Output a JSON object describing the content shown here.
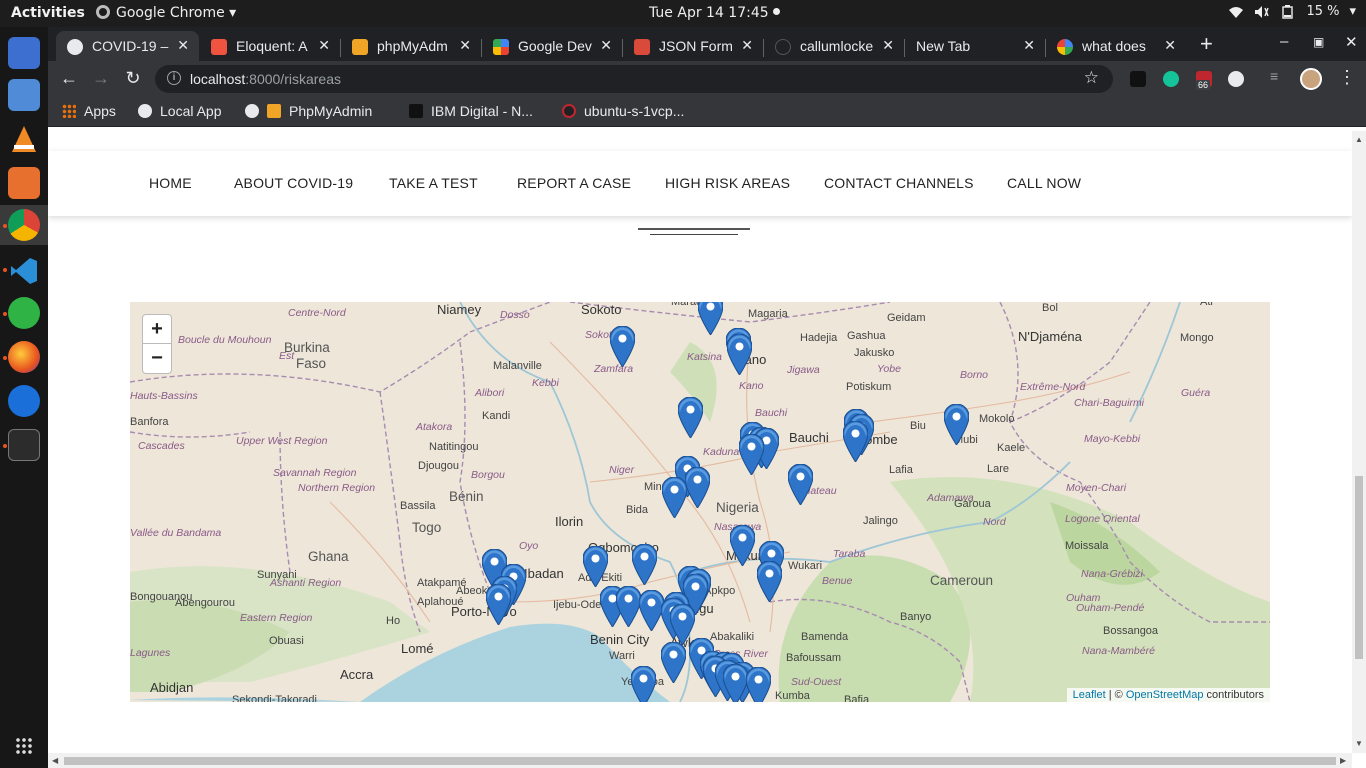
{
  "system": {
    "activities": "Activities",
    "app_name": "Google Chrome",
    "clock": "Tue Apr 14  17:45",
    "battery": "15 %"
  },
  "browser": {
    "tabs": [
      {
        "title": "COVID-19 –",
        "active": true
      },
      {
        "title": "Eloquent: A",
        "active": false
      },
      {
        "title": "phpMyAdm",
        "active": false
      },
      {
        "title": "Google Dev",
        "active": false
      },
      {
        "title": "JSON Form",
        "active": false
      },
      {
        "title": "callumlocke",
        "active": false
      },
      {
        "title": "New Tab",
        "active": false
      },
      {
        "title": "what does",
        "active": false
      }
    ],
    "url_host": "localhost",
    "url_path": ":8000/riskareas",
    "extension_badge": "66",
    "bookmarks": [
      "Apps",
      "Local App",
      "PhpMyAdmin",
      "IBM Digital - N...",
      "ubuntu-s-1vcp..."
    ]
  },
  "nav": {
    "items": [
      "HOME",
      "ABOUT COVID-19",
      "TAKE A TEST",
      "REPORT A CASE",
      "HIGH RISK AREAS",
      "CONTACT CHANNELS",
      "CALL NOW"
    ]
  },
  "map": {
    "zoom_in": "+",
    "zoom_out": "−",
    "attribution": {
      "leaflet": "Leaflet",
      "sep": " | © ",
      "osm": "OpenStreetMap",
      "suffix": " contributors"
    },
    "places": [
      {
        "t": "Niamey",
        "cls": "big"
      },
      {
        "t": "Sokoto",
        "cls": "big"
      },
      {
        "t": "Maradi",
        "cls": ""
      },
      {
        "t": "Magaria",
        "cls": ""
      },
      {
        "t": "Geidam",
        "cls": ""
      },
      {
        "t": "Bol",
        "cls": ""
      },
      {
        "t": "Ati",
        "cls": ""
      },
      {
        "t": "Centre-Nord",
        "cls": "region"
      },
      {
        "t": "Dosso",
        "cls": "region"
      },
      {
        "t": "Sokoto",
        "cls": "region"
      },
      {
        "t": "Hadejia",
        "cls": ""
      },
      {
        "t": "Gashua",
        "cls": ""
      },
      {
        "t": "N'Djaména",
        "cls": "big"
      },
      {
        "t": "Mongo",
        "cls": ""
      },
      {
        "t": "Boucle du Mouhoun",
        "cls": "region"
      },
      {
        "t": "Burkina",
        "cls": "country"
      },
      {
        "t": "Faso",
        "cls": "country"
      },
      {
        "t": "Malanville",
        "cls": ""
      },
      {
        "t": "Zamfara",
        "cls": "region"
      },
      {
        "t": "Katsina",
        "cls": "region"
      },
      {
        "t": "Kano",
        "cls": "big"
      },
      {
        "t": "Jigawa",
        "cls": "region"
      },
      {
        "t": "Jakusko",
        "cls": ""
      },
      {
        "t": "Yobe",
        "cls": "region"
      },
      {
        "t": "Borno",
        "cls": "region"
      },
      {
        "t": "Est",
        "cls": "region"
      },
      {
        "t": "Alibori",
        "cls": "region"
      },
      {
        "t": "Kebbi",
        "cls": "region"
      },
      {
        "t": "Kano",
        "cls": "region"
      },
      {
        "t": "Potiskum",
        "cls": ""
      },
      {
        "t": "Extrême-Nord",
        "cls": "region"
      },
      {
        "t": "Chari-Baguirmi",
        "cls": "region"
      },
      {
        "t": "Guéra",
        "cls": "region"
      },
      {
        "t": "Hauts-Bassins",
        "cls": "region"
      },
      {
        "t": "Kandi",
        "cls": ""
      },
      {
        "t": "Bauchi",
        "cls": "region"
      },
      {
        "t": "Banfora",
        "cls": ""
      },
      {
        "t": "Atakora",
        "cls": "region"
      },
      {
        "t": "Bauchi",
        "cls": "big"
      },
      {
        "t": "Gombe",
        "cls": "big"
      },
      {
        "t": "Biu",
        "cls": ""
      },
      {
        "t": "Mubi",
        "cls": ""
      },
      {
        "t": "Mokolo",
        "cls": ""
      },
      {
        "t": "Mayo-Kebbi",
        "cls": "region"
      },
      {
        "t": "Cascades",
        "cls": "region"
      },
      {
        "t": "Upper West Region",
        "cls": "region"
      },
      {
        "t": "Natitingou",
        "cls": ""
      },
      {
        "t": "Kaduna",
        "cls": "region"
      },
      {
        "t": "Kaele",
        "cls": ""
      },
      {
        "t": "Djougou",
        "cls": ""
      },
      {
        "t": "Niger",
        "cls": "region"
      },
      {
        "t": "Lafia",
        "cls": ""
      },
      {
        "t": "Lare",
        "cls": ""
      },
      {
        "t": "Borgou",
        "cls": "region"
      },
      {
        "t": "Plateau",
        "cls": "region"
      },
      {
        "t": "Savannah Region",
        "cls": "region"
      },
      {
        "t": "Northern Region",
        "cls": "region"
      },
      {
        "t": "Bénin",
        "cls": "country"
      },
      {
        "t": "Minna",
        "cls": ""
      },
      {
        "t": "Adamawa",
        "cls": "region"
      },
      {
        "t": "Garoua",
        "cls": ""
      },
      {
        "t": "Moyen-Chari",
        "cls": "region"
      },
      {
        "t": "Bassila",
        "cls": ""
      },
      {
        "t": "Bida",
        "cls": ""
      },
      {
        "t": "Nigeria",
        "cls": "country"
      },
      {
        "t": "Jalingo",
        "cls": ""
      },
      {
        "t": "Nord",
        "cls": "region"
      },
      {
        "t": "Vallée du Bandama",
        "cls": "region"
      },
      {
        "t": "Togo",
        "cls": "country"
      },
      {
        "t": "Ilorin",
        "cls": "big"
      },
      {
        "t": "Oyo",
        "cls": "region"
      },
      {
        "t": "Nasarawa",
        "cls": "region"
      },
      {
        "t": "Logone Oriental",
        "cls": "region"
      },
      {
        "t": "Ghana",
        "cls": "country"
      },
      {
        "t": "Ogbomosho",
        "cls": "big"
      },
      {
        "t": "Makurdi",
        "cls": "big"
      },
      {
        "t": "Taraba",
        "cls": "region"
      },
      {
        "t": "Moissala",
        "cls": ""
      },
      {
        "t": "Sunyani",
        "cls": ""
      },
      {
        "t": "Atakpamé",
        "cls": ""
      },
      {
        "t": "Ibadan",
        "cls": "big"
      },
      {
        "t": "Ado-Ekiti",
        "cls": ""
      },
      {
        "t": "Wukari",
        "cls": ""
      },
      {
        "t": "Cameroun",
        "cls": "country"
      },
      {
        "t": "Nana-Grébizi",
        "cls": "region"
      },
      {
        "t": "Abeokuta",
        "cls": ""
      },
      {
        "t": "Apkpo",
        "cls": ""
      },
      {
        "t": "Ashanti Region",
        "cls": "region"
      },
      {
        "t": "Aplahoué",
        "cls": ""
      },
      {
        "t": "Ijebu-Ode",
        "cls": ""
      },
      {
        "t": "Enugu",
        "cls": "big"
      },
      {
        "t": "Benue",
        "cls": "region"
      },
      {
        "t": "Ouham",
        "cls": "region"
      },
      {
        "t": "Bongouanou",
        "cls": ""
      },
      {
        "t": "Abengourou",
        "cls": ""
      },
      {
        "t": "Porto-Novo",
        "cls": "big"
      },
      {
        "t": "Ouham-Pendé",
        "cls": "region"
      },
      {
        "t": "Eastern Region",
        "cls": "region"
      },
      {
        "t": "Ho",
        "cls": ""
      },
      {
        "t": "Benin City",
        "cls": "big"
      },
      {
        "t": "Awka",
        "cls": "big"
      },
      {
        "t": "Abakaliki",
        "cls": ""
      },
      {
        "t": "Banyo",
        "cls": ""
      },
      {
        "t": "Bossangoa",
        "cls": ""
      },
      {
        "t": "Obuasi",
        "cls": ""
      },
      {
        "t": "Lomé",
        "cls": "big"
      },
      {
        "t": "Warri",
        "cls": ""
      },
      {
        "t": "Bamenda",
        "cls": ""
      },
      {
        "t": "Lagunes",
        "cls": "region"
      },
      {
        "t": "Bafoussam",
        "cls": ""
      },
      {
        "t": "Nana-Mambéré",
        "cls": "region"
      },
      {
        "t": "Accra",
        "cls": "big"
      },
      {
        "t": "Yenagoa",
        "cls": ""
      },
      {
        "t": "Cross River",
        "cls": "region"
      },
      {
        "t": "Abidjan",
        "cls": "big"
      },
      {
        "t": "Sud-Ouest",
        "cls": "region"
      },
      {
        "t": "Kumba",
        "cls": ""
      },
      {
        "t": "Sekondi-Takoradi",
        "cls": ""
      },
      {
        "t": "Bafia",
        "cls": ""
      }
    ]
  }
}
